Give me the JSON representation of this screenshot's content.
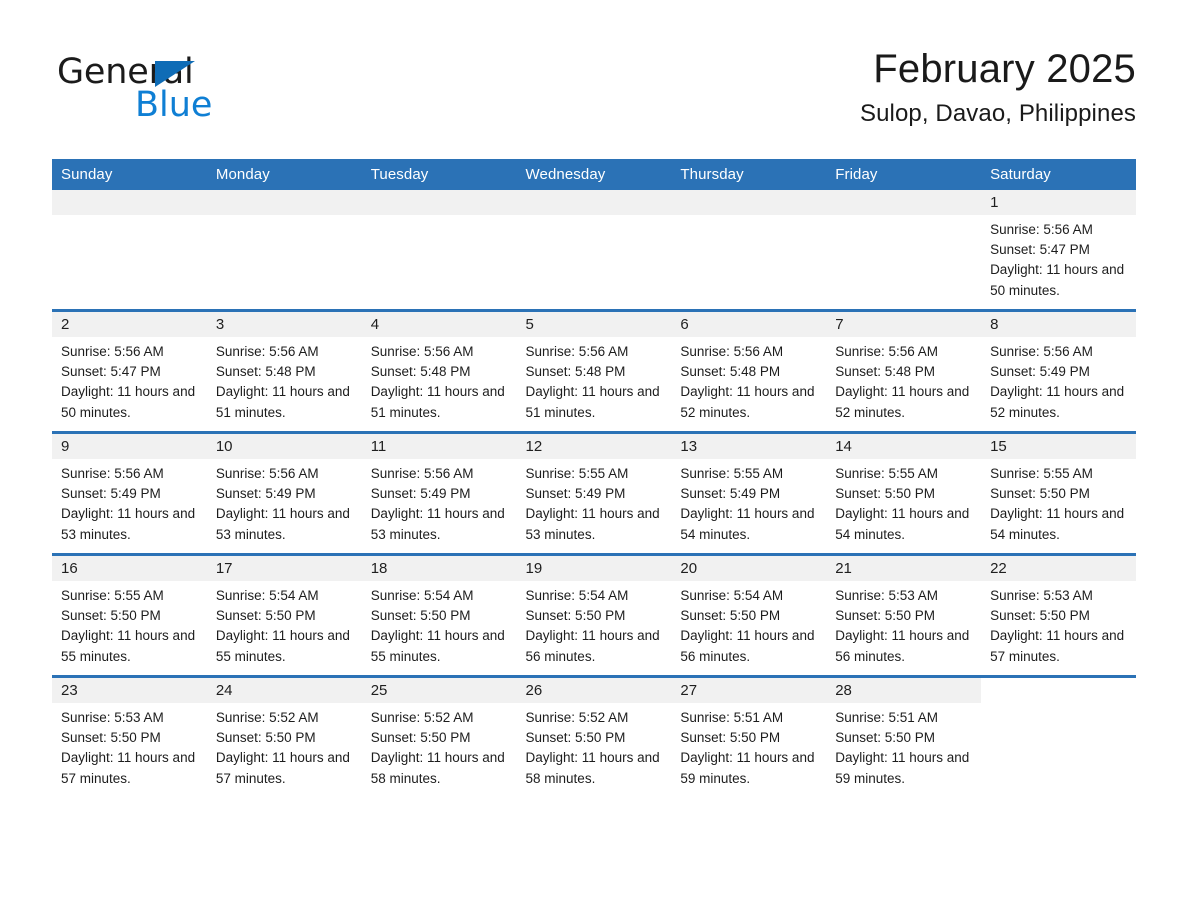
{
  "brand": {
    "name_part1": "General",
    "name_part2": "Blue",
    "logo_icon": "blue-triangle-icon",
    "colors": {
      "blue": "#0f7fd4",
      "triangle": "#0f6cb6",
      "dark": "#1b1b1b"
    }
  },
  "header": {
    "month_title": "February 2025",
    "location": "Sulop, Davao, Philippines"
  },
  "theme": {
    "header_blue": "#2b72b6",
    "day_band_gray": "#f1f1f1",
    "text": "#1d1d1d"
  },
  "weekdays": [
    "Sunday",
    "Monday",
    "Tuesday",
    "Wednesday",
    "Thursday",
    "Friday",
    "Saturday"
  ],
  "weeks": [
    [
      {
        "day": "",
        "empty": true
      },
      {
        "day": "",
        "empty": true
      },
      {
        "day": "",
        "empty": true
      },
      {
        "day": "",
        "empty": true
      },
      {
        "day": "",
        "empty": true
      },
      {
        "day": "",
        "empty": true
      },
      {
        "day": "1",
        "sunrise": "Sunrise: 5:56 AM",
        "sunset": "Sunset: 5:47 PM",
        "daylight": "Daylight: 11 hours and 50 minutes."
      }
    ],
    [
      {
        "day": "2",
        "sunrise": "Sunrise: 5:56 AM",
        "sunset": "Sunset: 5:47 PM",
        "daylight": "Daylight: 11 hours and 50 minutes."
      },
      {
        "day": "3",
        "sunrise": "Sunrise: 5:56 AM",
        "sunset": "Sunset: 5:48 PM",
        "daylight": "Daylight: 11 hours and 51 minutes."
      },
      {
        "day": "4",
        "sunrise": "Sunrise: 5:56 AM",
        "sunset": "Sunset: 5:48 PM",
        "daylight": "Daylight: 11 hours and 51 minutes."
      },
      {
        "day": "5",
        "sunrise": "Sunrise: 5:56 AM",
        "sunset": "Sunset: 5:48 PM",
        "daylight": "Daylight: 11 hours and 51 minutes."
      },
      {
        "day": "6",
        "sunrise": "Sunrise: 5:56 AM",
        "sunset": "Sunset: 5:48 PM",
        "daylight": "Daylight: 11 hours and 52 minutes."
      },
      {
        "day": "7",
        "sunrise": "Sunrise: 5:56 AM",
        "sunset": "Sunset: 5:48 PM",
        "daylight": "Daylight: 11 hours and 52 minutes."
      },
      {
        "day": "8",
        "sunrise": "Sunrise: 5:56 AM",
        "sunset": "Sunset: 5:49 PM",
        "daylight": "Daylight: 11 hours and 52 minutes."
      }
    ],
    [
      {
        "day": "9",
        "sunrise": "Sunrise: 5:56 AM",
        "sunset": "Sunset: 5:49 PM",
        "daylight": "Daylight: 11 hours and 53 minutes."
      },
      {
        "day": "10",
        "sunrise": "Sunrise: 5:56 AM",
        "sunset": "Sunset: 5:49 PM",
        "daylight": "Daylight: 11 hours and 53 minutes."
      },
      {
        "day": "11",
        "sunrise": "Sunrise: 5:56 AM",
        "sunset": "Sunset: 5:49 PM",
        "daylight": "Daylight: 11 hours and 53 minutes."
      },
      {
        "day": "12",
        "sunrise": "Sunrise: 5:55 AM",
        "sunset": "Sunset: 5:49 PM",
        "daylight": "Daylight: 11 hours and 53 minutes."
      },
      {
        "day": "13",
        "sunrise": "Sunrise: 5:55 AM",
        "sunset": "Sunset: 5:49 PM",
        "daylight": "Daylight: 11 hours and 54 minutes."
      },
      {
        "day": "14",
        "sunrise": "Sunrise: 5:55 AM",
        "sunset": "Sunset: 5:50 PM",
        "daylight": "Daylight: 11 hours and 54 minutes."
      },
      {
        "day": "15",
        "sunrise": "Sunrise: 5:55 AM",
        "sunset": "Sunset: 5:50 PM",
        "daylight": "Daylight: 11 hours and 54 minutes."
      }
    ],
    [
      {
        "day": "16",
        "sunrise": "Sunrise: 5:55 AM",
        "sunset": "Sunset: 5:50 PM",
        "daylight": "Daylight: 11 hours and 55 minutes."
      },
      {
        "day": "17",
        "sunrise": "Sunrise: 5:54 AM",
        "sunset": "Sunset: 5:50 PM",
        "daylight": "Daylight: 11 hours and 55 minutes."
      },
      {
        "day": "18",
        "sunrise": "Sunrise: 5:54 AM",
        "sunset": "Sunset: 5:50 PM",
        "daylight": "Daylight: 11 hours and 55 minutes."
      },
      {
        "day": "19",
        "sunrise": "Sunrise: 5:54 AM",
        "sunset": "Sunset: 5:50 PM",
        "daylight": "Daylight: 11 hours and 56 minutes."
      },
      {
        "day": "20",
        "sunrise": "Sunrise: 5:54 AM",
        "sunset": "Sunset: 5:50 PM",
        "daylight": "Daylight: 11 hours and 56 minutes."
      },
      {
        "day": "21",
        "sunrise": "Sunrise: 5:53 AM",
        "sunset": "Sunset: 5:50 PM",
        "daylight": "Daylight: 11 hours and 56 minutes."
      },
      {
        "day": "22",
        "sunrise": "Sunrise: 5:53 AM",
        "sunset": "Sunset: 5:50 PM",
        "daylight": "Daylight: 11 hours and 57 minutes."
      }
    ],
    [
      {
        "day": "23",
        "sunrise": "Sunrise: 5:53 AM",
        "sunset": "Sunset: 5:50 PM",
        "daylight": "Daylight: 11 hours and 57 minutes."
      },
      {
        "day": "24",
        "sunrise": "Sunrise: 5:52 AM",
        "sunset": "Sunset: 5:50 PM",
        "daylight": "Daylight: 11 hours and 57 minutes."
      },
      {
        "day": "25",
        "sunrise": "Sunrise: 5:52 AM",
        "sunset": "Sunset: 5:50 PM",
        "daylight": "Daylight: 11 hours and 58 minutes."
      },
      {
        "day": "26",
        "sunrise": "Sunrise: 5:52 AM",
        "sunset": "Sunset: 5:50 PM",
        "daylight": "Daylight: 11 hours and 58 minutes."
      },
      {
        "day": "27",
        "sunrise": "Sunrise: 5:51 AM",
        "sunset": "Sunset: 5:50 PM",
        "daylight": "Daylight: 11 hours and 59 minutes."
      },
      {
        "day": "28",
        "sunrise": "Sunrise: 5:51 AM",
        "sunset": "Sunset: 5:50 PM",
        "daylight": "Daylight: 11 hours and 59 minutes."
      },
      {
        "day": "",
        "empty": true,
        "blank": true
      }
    ]
  ]
}
